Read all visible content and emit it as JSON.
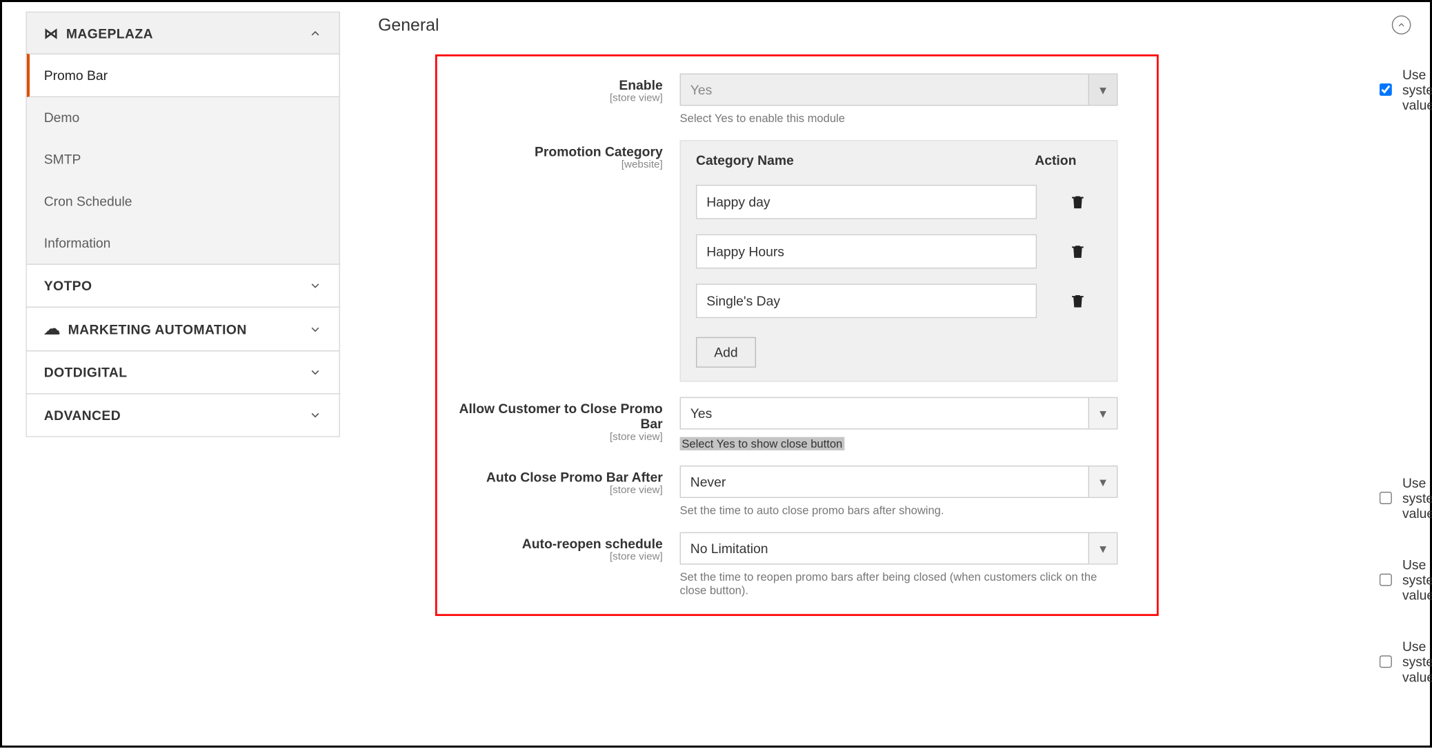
{
  "sidebar": {
    "mageplaza": {
      "label": "MAGEPLAZA",
      "expanded": true,
      "items": [
        {
          "label": "Promo Bar",
          "active": true
        },
        {
          "label": "Demo"
        },
        {
          "label": "SMTP"
        },
        {
          "label": "Cron Schedule"
        },
        {
          "label": "Information"
        }
      ]
    },
    "yotpo": {
      "label": "YOTPO"
    },
    "marketing_automation": {
      "label": "MARKETING AUTOMATION"
    },
    "dotdigital": {
      "label": "DOTDIGITAL"
    },
    "advanced": {
      "label": "ADVANCED"
    }
  },
  "section_title": "General",
  "scope": {
    "store_view": "[store view]",
    "website": "[website]"
  },
  "use_system": "Use system value",
  "enable": {
    "label": "Enable",
    "value": "Yes",
    "note": "Select Yes to enable this module",
    "use_system": true
  },
  "promotion_category": {
    "label": "Promotion Category",
    "columns": {
      "name": "Category Name",
      "action": "Action"
    },
    "rows": [
      "Happy day",
      "Happy Hours",
      "Single's Day"
    ],
    "add_label": "Add"
  },
  "allow_close": {
    "label": "Allow Customer to Close Promo Bar",
    "value": "Yes",
    "note": "Select Yes to show close button",
    "use_system": false
  },
  "auto_close": {
    "label": "Auto Close Promo Bar After",
    "value": "Never",
    "note": "Set the time to auto close promo bars after showing.",
    "use_system": false
  },
  "auto_reopen": {
    "label": "Auto-reopen schedule",
    "value": "No Limitation",
    "note": "Set the time to reopen promo bars after being closed (when customers click on the close button).",
    "use_system": false
  }
}
